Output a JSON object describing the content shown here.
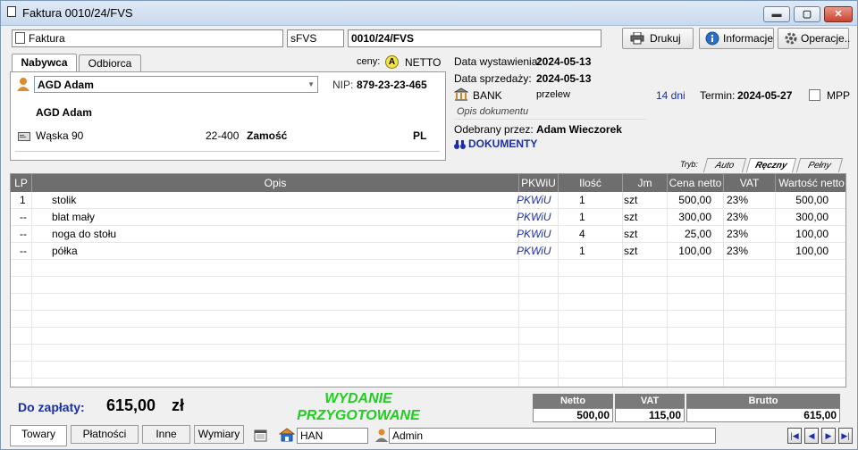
{
  "window": {
    "title": "Faktura 0010/24/FVS",
    "minimize": "▬",
    "maximize": "▢",
    "close": "✕"
  },
  "toolbar": {
    "doc_type": "Faktura",
    "series": "sFVS",
    "number": "0010/24/FVS",
    "print_label": "Drukuj",
    "info_label": "Informacje",
    "ops_label": "Operacje.."
  },
  "buyer": {
    "tab_buyer": "Nabywca",
    "tab_receiver": "Odbiorca",
    "prices_label": "ceny:",
    "prices_badge": "A",
    "prices_value": "NETTO",
    "name_select": "AGD Adam",
    "nip_label": "NIP:",
    "nip_value": "879-23-23-465",
    "full_name": "AGD Adam",
    "street": "Wąska 90",
    "postal": "22-400",
    "city": "Zamość",
    "country": "PL"
  },
  "dates": {
    "issue_label": "Data wystawienia:",
    "issue_value": "2024-05-13",
    "sale_label": "Data sprzedaży:",
    "sale_value": "2024-05-13",
    "payment_method": "BANK",
    "payment_type": "przelew",
    "days": "14 dni",
    "term_label": "Termin:",
    "term_value": "2024-05-27",
    "mpp_label": "MPP",
    "desc_placeholder": "Opis dokumentu",
    "received_label": "Odebrany przez:",
    "received_value": "Adam Wieczorek",
    "documents_label": "DOKUMENTY"
  },
  "mode_tabs": {
    "label": "Tryb:",
    "auto": "Auto",
    "manual": "Ręczny",
    "full": "Pełny"
  },
  "table": {
    "columns": [
      "LP",
      "Opis",
      "PKWiU",
      "Ilość",
      "Jm",
      "Cena netto",
      "VAT",
      "Wartość netto"
    ],
    "rows": [
      {
        "lp": "1",
        "opis": "stolik",
        "pkwiu": "PKWiU",
        "ilosc": "1",
        "jm": "szt",
        "cena": "500,00",
        "vat": "23%",
        "wartosc": "500,00"
      },
      {
        "lp": "--",
        "opis": "blat mały",
        "pkwiu": "PKWiU",
        "ilosc": "1",
        "jm": "szt",
        "cena": "300,00",
        "vat": "23%",
        "wartosc": "300,00"
      },
      {
        "lp": "--",
        "opis": "noga do stołu",
        "pkwiu": "PKWiU",
        "ilosc": "4",
        "jm": "szt",
        "cena": "25,00",
        "vat": "23%",
        "wartosc": "100,00"
      },
      {
        "lp": "--",
        "opis": "półka",
        "pkwiu": "PKWiU",
        "ilosc": "1",
        "jm": "szt",
        "cena": "100,00",
        "vat": "23%",
        "wartosc": "100,00"
      }
    ]
  },
  "summary": {
    "to_pay_label": "Do zapłaty:",
    "to_pay_value": "615,00",
    "currency": "zł",
    "status_line1": "WYDANIE",
    "status_line2": "PRZYGOTOWANE",
    "netto_label": "Netto",
    "netto_value": "500,00",
    "vat_label": "VAT",
    "vat_value": "115,00",
    "brutto_label": "Brutto",
    "brutto_value": "615,00"
  },
  "bottom": {
    "tab_goods": "Towary",
    "tab_payments": "Płatności",
    "tab_other": "Inne",
    "tab_exchange": "Wymiary",
    "warehouse": "HAN",
    "user": "Admin",
    "nav_first": "|◀",
    "nav_prev": "◀",
    "nav_next": "▶",
    "nav_last": "▶|"
  },
  "colors": {
    "accent_blue": "#1a2ea8",
    "status_green": "#22cc22",
    "header_gray": "#6e6e6e"
  }
}
